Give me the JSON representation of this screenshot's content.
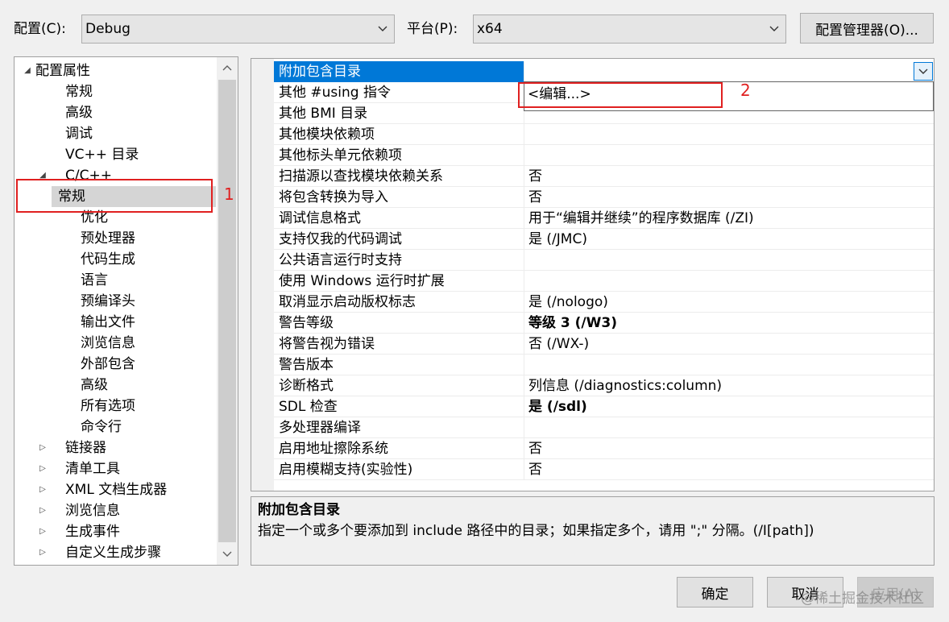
{
  "top": {
    "config_label": "配置(C):",
    "config_value": "Debug",
    "platform_label": "平台(P):",
    "platform_value": "x64",
    "config_manager_label": "配置管理器(O)..."
  },
  "tree": {
    "items": [
      {
        "label": "配置属性",
        "level": 0,
        "expanded": true
      },
      {
        "label": "常规",
        "level": 1
      },
      {
        "label": "高级",
        "level": 1
      },
      {
        "label": "调试",
        "level": 1
      },
      {
        "label": "VC++ 目录",
        "level": 1
      },
      {
        "label": "C/C++",
        "level": 1,
        "expanded": true
      },
      {
        "label": "常规",
        "level": 2,
        "selected": true
      },
      {
        "label": "优化",
        "level": 2
      },
      {
        "label": "预处理器",
        "level": 2
      },
      {
        "label": "代码生成",
        "level": 2
      },
      {
        "label": "语言",
        "level": 2
      },
      {
        "label": "预编译头",
        "level": 2
      },
      {
        "label": "输出文件",
        "level": 2
      },
      {
        "label": "浏览信息",
        "level": 2
      },
      {
        "label": "外部包含",
        "level": 2
      },
      {
        "label": "高级",
        "level": 2
      },
      {
        "label": "所有选项",
        "level": 2
      },
      {
        "label": "命令行",
        "level": 2
      },
      {
        "label": "链接器",
        "level": 1,
        "expanded": false
      },
      {
        "label": "清单工具",
        "level": 1,
        "expanded": false
      },
      {
        "label": "XML 文档生成器",
        "level": 1,
        "expanded": false
      },
      {
        "label": "浏览信息",
        "level": 1,
        "expanded": false
      },
      {
        "label": "生成事件",
        "level": 1,
        "expanded": false
      },
      {
        "label": "自定义生成步骤",
        "level": 1,
        "expanded": false
      }
    ]
  },
  "grid": {
    "rows": [
      {
        "name": "附加包含目录",
        "value": "",
        "selected": true
      },
      {
        "name": "其他 #using 指令",
        "value": ""
      },
      {
        "name": "其他 BMI 目录",
        "value": ""
      },
      {
        "name": "其他模块依赖项",
        "value": ""
      },
      {
        "name": "其他标头单元依赖项",
        "value": ""
      },
      {
        "name": "扫描源以查找模块依赖关系",
        "value": "否"
      },
      {
        "name": "将包含转换为导入",
        "value": "否"
      },
      {
        "name": "调试信息格式",
        "value": "用于“编辑并继续”的程序数据库 (/ZI)"
      },
      {
        "name": "支持仅我的代码调试",
        "value": "是 (/JMC)"
      },
      {
        "name": "公共语言运行时支持",
        "value": ""
      },
      {
        "name": "使用 Windows 运行时扩展",
        "value": ""
      },
      {
        "name": "取消显示启动版权标志",
        "value": "是 (/nologo)"
      },
      {
        "name": "警告等级",
        "value": "等级 3 (/W3)",
        "bold": true
      },
      {
        "name": "将警告视为错误",
        "value": "否 (/WX-)"
      },
      {
        "name": "警告版本",
        "value": ""
      },
      {
        "name": "诊断格式",
        "value": "列信息 (/diagnostics:column)"
      },
      {
        "name": "SDL 检查",
        "value": "是 (/sdl)",
        "bold": true
      },
      {
        "name": "多处理器编译",
        "value": ""
      },
      {
        "name": "启用地址擦除系统",
        "value": "否"
      },
      {
        "name": "启用模糊支持(实验性)",
        "value": "否"
      }
    ],
    "dropdown_option": "<编辑...>"
  },
  "annotations": {
    "marker_1": "1",
    "marker_2": "2",
    "color": "#e02020"
  },
  "description": {
    "title": "附加包含目录",
    "text": "指定一个或多个要添加到 include 路径中的目录；如果指定多个，请用 \";\" 分隔。(/I[path])"
  },
  "buttons": {
    "ok": "确定",
    "cancel": "取消",
    "apply": "应用(A)"
  },
  "watermark": "@稀土掘金技术社区",
  "colors": {
    "selection_blue": "#0078d7",
    "tree_selection": "#d5d5d5"
  }
}
